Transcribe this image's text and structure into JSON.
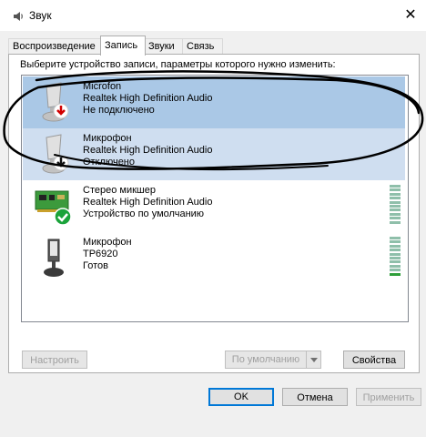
{
  "window": {
    "title": "Звук",
    "close_glyph": "✕"
  },
  "tabs": [
    {
      "label": "Воспроизведение",
      "active": false
    },
    {
      "label": "Запись",
      "active": true
    },
    {
      "label": "Звуки",
      "active": false
    },
    {
      "label": "Связь",
      "active": false
    }
  ],
  "panel": {
    "instruction": "Выберите устройство записи, параметры которого нужно изменить:"
  },
  "devices": [
    {
      "name": "Microfon",
      "driver": "Realtek High Definition Audio",
      "status": "Не подключено",
      "icon": "microphone-icon",
      "badge": "red-down-arrow-badge",
      "selected": "primary",
      "meter_level": null
    },
    {
      "name": "Микрофон",
      "driver": "Realtek High Definition Audio",
      "status": "Отключено",
      "icon": "microphone-icon",
      "badge": "black-down-arrow-badge",
      "selected": "secondary",
      "meter_level": null
    },
    {
      "name": "Стерео микшер",
      "driver": "Realtek High Definition Audio",
      "status": "Устройство по умолчанию",
      "icon": "sound-card-icon",
      "badge": "green-check-badge",
      "selected": "none",
      "meter_level": 0
    },
    {
      "name": "Микрофон",
      "driver": "TP6920",
      "status": "Готов",
      "icon": "microphone-icon",
      "badge": "none",
      "selected": "none",
      "meter_level": 0.1
    }
  ],
  "buttons": {
    "configure": "Настроить",
    "set_default": "По умолчанию",
    "properties": "Свойства",
    "ok": "OK",
    "cancel": "Отмена",
    "apply": "Применить"
  },
  "colors": {
    "selection_primary": "#aac8e6",
    "selection_secondary": "#cfdef0",
    "accent": "#0078d7",
    "meter_idle": "#8fbfaa",
    "meter_active": "#2e9e3a"
  }
}
